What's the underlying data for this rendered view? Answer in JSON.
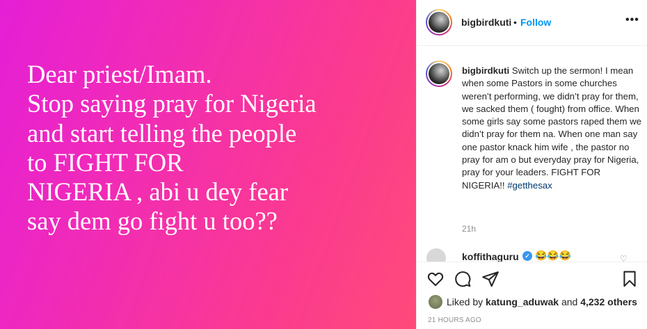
{
  "media": {
    "text": "Dear priest/Imam.\nStop saying pray for Nigeria\nand start telling the people\nto FIGHT FOR\nNIGERIA , abi u dey fear\nsay dem go fight u too??"
  },
  "header": {
    "username": "bigbirdkuti",
    "dot": "•",
    "follow_label": "Follow",
    "more_label": "•••"
  },
  "caption": {
    "username": "bigbirdkuti",
    "text": "Switch up the sermon! I mean when some Pastors in some churches weren’t performing, we didn’t pray for them, we sacked them ( fought) from office. When some girls say some pastors raped them we didn’t pray for them na. When one man say one pastor knack him wife , the pastor no pray for am o but everyday pray for Nigeria, pray for your leaders. FIGHT FOR NIGERIA!! ",
    "hashtag": "#getthesax",
    "time": "21h"
  },
  "comment": {
    "username": "koffithaguru",
    "verified_mark": "✓",
    "text": "😂😂😂",
    "heart": "♡"
  },
  "likes": {
    "prefix": "Liked by ",
    "user": "katung_aduwak",
    "middle": " and ",
    "count": "4,232 others"
  },
  "timestamp": "21 HOURS AGO",
  "icons": [
    "heart-icon",
    "comment-icon",
    "share-icon",
    "bookmark-icon"
  ],
  "colors": {
    "accent": "#0095f6",
    "gradient_start": "#e51fd6",
    "gradient_end": "#ff4a7a"
  }
}
